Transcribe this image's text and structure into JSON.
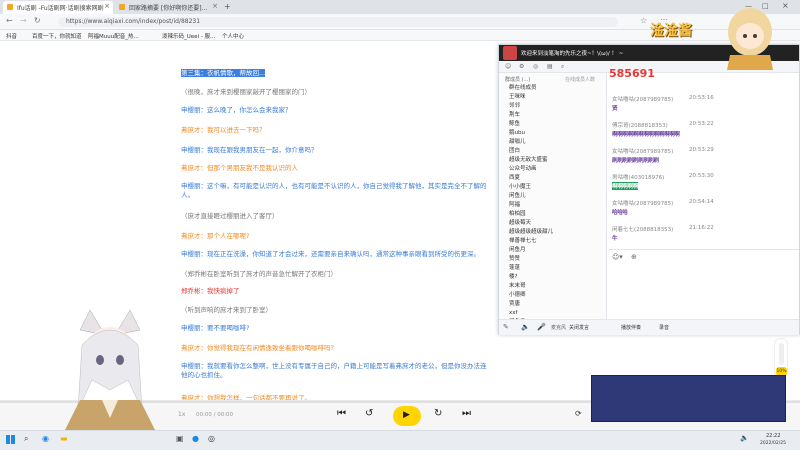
{
  "browser": {
    "tabs": [
      {
        "label": "Ifu话剧 -Fu话剧网·话剧搜索网剧"
      },
      {
        "label": "回家路摘要 [你好啊你还要]..."
      }
    ],
    "url": "https://www.aiqiaxi.com/index/post/id/88231",
    "bookmarks": [
      "抖音",
      "百度一下，你就知道",
      "阿福Muuu配音_热...",
      "泼辣乐码_Ueei - 服...",
      "个人中心"
    ]
  },
  "script": {
    "title": "第三集：衣帆情歌，帮故回...",
    "lines": [
      {
        "text": "（很晚，庶才来到樱丽家敲开了樱丽家的门）",
        "style": "gray"
      },
      {
        "text": "申樱丽：这么晚了，你怎么会来我家？",
        "style": "blue"
      },
      {
        "text": "弗庶才：我可以进去一下吗？",
        "style": "orange"
      },
      {
        "text": "申樱丽：我现在跟我男朋友在一起，你介意吗？",
        "style": "blue"
      },
      {
        "text": "弗庶才：但那个男朋友我不是我认识的人",
        "style": "orange"
      },
      {
        "text": "申樱丽：这个嘛，有可能是认识的人，也有可能是不认识的人，你自己觉得我了解他，其实是完全不了解的人。",
        "style": "blue"
      },
      {
        "text": "（庶才直接瞪过樱丽进入了客厅）",
        "style": "gray"
      },
      {
        "text": "弗庶才：那个人在哪呢?",
        "style": "orange"
      },
      {
        "text": "申樱丽：现在正在洗澡，你知道了才会过来，还需要亲自来确认吗，通常这种事亲眼看到所受的伤更深。",
        "style": "blue"
      },
      {
        "text": "（郑乔彬在卧室听到了庶才的声音急忙解开了衣柜门）",
        "style": "gray"
      },
      {
        "text": "郑乔彬：我快疯掉了",
        "style": "red"
      },
      {
        "text": "（听到声响的庶才来到了卧室）",
        "style": "gray"
      },
      {
        "text": "申樱丽：要不要喝咖啡?",
        "style": "blue"
      },
      {
        "text": "弗庶才：你觉得我现在有闲情逸致坐着跟你喝咖啡吗?",
        "style": "orange"
      },
      {
        "text": "申樱丽：我就要看你怎么整啊，世上没有专属于自己的，户籍上可能是写着弗庶才的老公，但是你没办法连他的心也抓住。",
        "style": "blue"
      },
      {
        "text": "弗庶才：你想我怎样，一句话都不要再说了。",
        "style": "orange"
      }
    ]
  },
  "player": {
    "time": "00:00 / 00:00"
  },
  "qq": {
    "banner": "欢迎来到淡笔淘的先乐之夜~！\\(ω)/ ！ ~",
    "list_header": "群成员 (...)",
    "count_label": "在线成员人数",
    "members": [
      "群在线成员",
      "王咪咪",
      "邻邻",
      "荆车",
      "鲸鱼",
      "鹅ubu",
      "甜咖儿",
      "团白",
      "超级无敌大盛蜜",
      "公众号动画",
      "西夏",
      "小小魔王",
      "闲鱼儿",
      "阿福",
      "柏柏园",
      "超级莓天",
      "超级超级超级甜儿",
      "禅善禅七七",
      "闲鱼月",
      "赞赞",
      "蓬蓬",
      "楼?",
      "末末哥",
      "小德卿",
      "贾唐",
      "xxf",
      "闲鱼月"
    ],
    "big_number": "585691",
    "messages": [
      {
        "name": "女咕噜咕(2087989785)",
        "time": "20:53:16",
        "text": "贤"
      },
      {
        "name": "傅宗哥(2088818353)",
        "time": "20:53:22",
        "text": "啊啊啊啊啊啊啊啊啊啊啊啊啊"
      },
      {
        "name": "女咕噜咕(2087989785)",
        "time": "20:53:29",
        "text": "刷刷刷刷刷刷刷刷刷"
      },
      {
        "name": "男咕噜(403018976)",
        "time": "20:53:30",
        "text": "啊啊啊啊啊"
      },
      {
        "name": "女咕噜咕(2087989785)",
        "time": "20:54:14",
        "text": "哈哈哈"
      },
      {
        "name": "闲着七七(2088818353)",
        "time": "21:16:22",
        "text": "牛"
      }
    ],
    "toolbar": [
      "麦克风",
      "关闭发言",
      "播放伴奏",
      "录音"
    ]
  },
  "overlay": {
    "logo_text": "淦淦酱",
    "progress_label": "10%"
  },
  "taskbar": {
    "time": "22:22",
    "date": "2022/02/25"
  }
}
